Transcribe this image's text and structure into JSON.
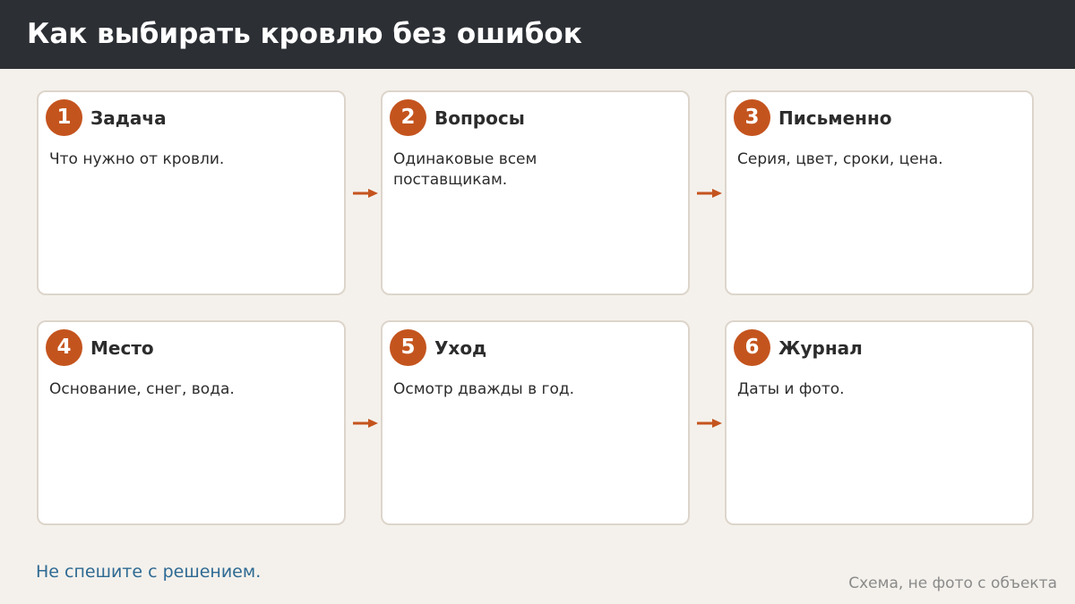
{
  "title": "Как выбирать кровлю без ошибок",
  "steps": [
    {
      "num": "1",
      "title": "Задача",
      "text": "Что нужно от кровли."
    },
    {
      "num": "2",
      "title": "Вопросы",
      "text": "Одинаковые всем поставщикам."
    },
    {
      "num": "3",
      "title": "Письменно",
      "text": "Серия, цвет, сроки, цена."
    },
    {
      "num": "4",
      "title": "Место",
      "text": "Основание, снег, вода."
    },
    {
      "num": "5",
      "title": "Уход",
      "text": "Осмотр дважды в год."
    },
    {
      "num": "6",
      "title": "Журнал",
      "text": "Даты и фото."
    }
  ],
  "footer_note": "Не спешите с решением.",
  "caption": "Схема, не фото с объекта",
  "colors": {
    "header_bg": "#2c2f34",
    "accent": "#c4541e",
    "page_bg": "#f4f1ec",
    "note": "#2e6a93"
  }
}
